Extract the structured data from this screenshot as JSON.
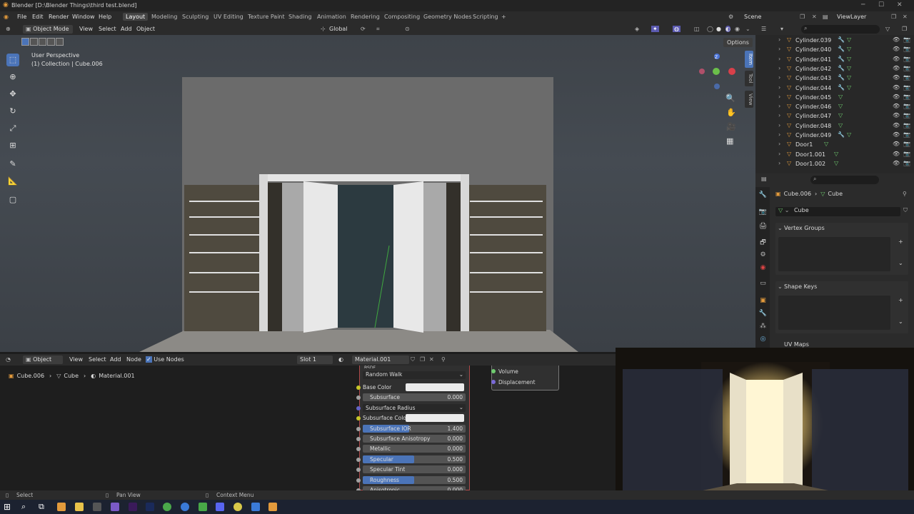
{
  "titlebar": {
    "title": "Blender [D:\\Blender Things\\third test.blend]"
  },
  "menu": {
    "items": [
      "File",
      "Edit",
      "Render",
      "Window",
      "Help"
    ]
  },
  "workspaces": [
    "Layout",
    "Modeling",
    "Sculpting",
    "UV Editing",
    "Texture Paint",
    "Shading",
    "Animation",
    "Rendering",
    "Compositing",
    "Geometry Nodes",
    "Scripting"
  ],
  "scene": {
    "name": "Scene",
    "view_layer": "ViewLayer"
  },
  "viewport": {
    "mode": "Object Mode",
    "header_menus": [
      "View",
      "Select",
      "Add",
      "Object"
    ],
    "orientation": "Global",
    "info_line1": "User Perspective",
    "info_line2": "(1) Collection | Cube.006",
    "options_label": "Options",
    "side_tabs": [
      "Item",
      "Tool",
      "View"
    ],
    "gizmo_axis_z": "Z"
  },
  "outliner": {
    "items": [
      "Cylinder.039",
      "Cylinder.040",
      "Cylinder.041",
      "Cylinder.042",
      "Cylinder.043",
      "Cylinder.044",
      "Cylinder.045",
      "Cylinder.046",
      "Cylinder.047",
      "Cylinder.048",
      "Cylinder.049",
      "Door1",
      "Door1.001",
      "Door1.002"
    ]
  },
  "properties": {
    "breadcrumb_object": "Cube.006",
    "breadcrumb_mesh": "Cube",
    "mesh_name": "Cube",
    "vertex_groups_label": "Vertex Groups",
    "shape_keys_label": "Shape Keys",
    "uv_maps_label": "UV Maps"
  },
  "node_editor": {
    "object_dropdown": "Object",
    "menus": [
      "View",
      "Select",
      "Add",
      "Node"
    ],
    "use_nodes_label": "Use Nodes",
    "slot": "Slot 1",
    "material": "Material.001",
    "breadcrumb": [
      "Cube.006",
      "Cube",
      "Material.001"
    ],
    "bsdf_top_label": "BSDF",
    "subsurface_method": "Random Walk",
    "fields": [
      {
        "label": "Base Color",
        "value": "",
        "kind": "color"
      },
      {
        "label": "Subsurface",
        "value": "0.000",
        "kind": "num"
      },
      {
        "label": "Subsurface Radius",
        "value": "",
        "kind": "dropdown"
      },
      {
        "label": "Subsurface Colo",
        "value": "",
        "kind": "color"
      },
      {
        "label": "Subsurface IOR",
        "value": "1.400",
        "kind": "bar"
      },
      {
        "label": "Subsurface Anisotropy",
        "value": "0.000",
        "kind": "num"
      },
      {
        "label": "Metallic",
        "value": "0.000",
        "kind": "num"
      },
      {
        "label": "Specular",
        "value": "0.500",
        "kind": "bar"
      },
      {
        "label": "Specular Tint",
        "value": "0.000",
        "kind": "num"
      },
      {
        "label": "Roughness",
        "value": "0.500",
        "kind": "bar"
      },
      {
        "label": "Anisotropic",
        "value": "0.000",
        "kind": "num"
      }
    ],
    "output_sockets": [
      "Volume",
      "Displacement"
    ]
  },
  "statusbar": {
    "select": "Select",
    "pan": "Pan View",
    "context": "Context Menu"
  },
  "colors": {
    "accent": "#4b74b8",
    "object_orange": "#e29a3c",
    "mesh_green": "#6fcc6f",
    "bg": "#1d1d1d"
  }
}
